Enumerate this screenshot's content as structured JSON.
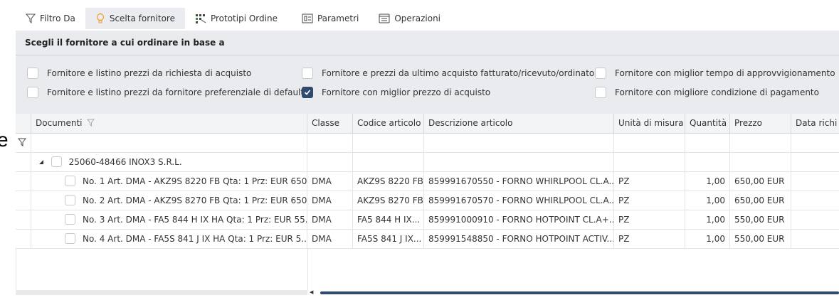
{
  "tabs": [
    {
      "label": "Filtro Da",
      "icon": "filter-icon"
    },
    {
      "label": "Scelta fornitore",
      "icon": "lightbulb-icon"
    },
    {
      "label": "Prototipi Ordine",
      "icon": "grid-icon"
    },
    {
      "label": "Parametri",
      "icon": "settings-list-icon"
    },
    {
      "label": "Operazioni",
      "icon": "window-icon"
    }
  ],
  "active_tab": "Scelta fornitore",
  "stray_glyph": "e",
  "supplier_panel": {
    "title": "Scegli il fornitore a cui ordinare in base a",
    "options": [
      {
        "label": "Fornitore e listino prezzi da richiesta di acquisto",
        "checked": false
      },
      {
        "label": "Fornitore e prezzi da ultimo acquisto fatturato/ricevuto/ordinato",
        "checked": false
      },
      {
        "label": "Fornitore con miglior tempo di approvvigionamento",
        "checked": false
      },
      {
        "label": "Fornitore e listino prezzi da fornitore preferenziale di default",
        "checked": false
      },
      {
        "label": "Fornitore con miglior prezzo di acquisto",
        "checked": true
      },
      {
        "label": "Fornitore con migliore condizione di pagamento",
        "checked": false
      }
    ]
  },
  "grid": {
    "columns": [
      "Documenti",
      "Classe",
      "Codice articolo",
      "Descrizione articolo",
      "Unità di misura",
      "Quantità",
      "Prezzo",
      "Data richi"
    ],
    "group": {
      "label": "25060-48466 INOX3 S.R.L."
    },
    "rows": [
      {
        "doc": "No. 1 Art. DMA - AKZ9S 8220 FB Qta: 1 Prz: EUR  650...",
        "classe": "DMA",
        "codice": "AKZ9S 8220 FB",
        "descrizione": "859991670550 - FORNO WHIRLPOOL CL.A...",
        "um": "PZ",
        "quantita": "1,00",
        "prezzo": "650,00 EUR"
      },
      {
        "doc": "No. 2 Art. DMA - AKZ9S 8270 FB Qta: 1 Prz: EUR  650...",
        "classe": "DMA",
        "codice": "AKZ9S 8270 FB",
        "descrizione": "859991670570 - FORNO WHIRLPOOL CL.A...",
        "um": "PZ",
        "quantita": "1,00",
        "prezzo": "650,00 EUR"
      },
      {
        "doc": "No. 3 Art. DMA - FA5 844 H IX HA Qta: 1 Prz: EUR  55...",
        "classe": "DMA",
        "codice": "FA5 844 H IX...",
        "descrizione": "859991000910 - FORNO HOTPOINT CL.A+...",
        "um": "PZ",
        "quantita": "1,00",
        "prezzo": "550,00 EUR"
      },
      {
        "doc": "No. 4 Art. DMA - FA5S 841 J IX HA Qta: 1 Prz: EUR  5...",
        "classe": "DMA",
        "codice": "FA5S 841 J IX...",
        "descrizione": "859991548850 - FORNO HOTPOINT ACTIV...",
        "um": "PZ",
        "quantita": "1,00",
        "prezzo": "550,00 EUR"
      }
    ]
  },
  "colors": {
    "accent": "#2f4a6d",
    "panel": "#e9ebee",
    "tab_active": "#eaecf0"
  }
}
